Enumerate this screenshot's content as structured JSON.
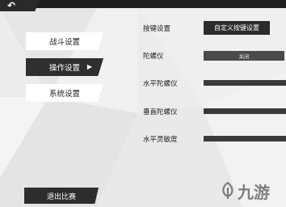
{
  "header": {
    "back_icon": "back-arrow-icon"
  },
  "sidebar": {
    "items": [
      {
        "label": "战斗设置",
        "active": false
      },
      {
        "label": "操作设置",
        "active": true,
        "icon": "triangle-right-icon"
      },
      {
        "label": "系统设置",
        "active": false
      }
    ],
    "exit_label": "退出比赛"
  },
  "settings": {
    "key_settings": {
      "label": "按键设置",
      "button_label": "自定义按键设置"
    },
    "gyroscope": {
      "label": "陀螺仪",
      "value": "关闭"
    },
    "horizontal_gyro": {
      "label": "水平陀螺仪"
    },
    "vertical_gyro": {
      "label": "垂直陀螺仪"
    },
    "horizontal_sensitivity": {
      "label": "水平灵敏度"
    }
  },
  "watermark": {
    "text": "九游",
    "icon": "jiuyou-logo-icon"
  },
  "colors": {
    "dark": "#2d2d2d",
    "light_bg": "#ececec",
    "panel": "#ffffff"
  }
}
